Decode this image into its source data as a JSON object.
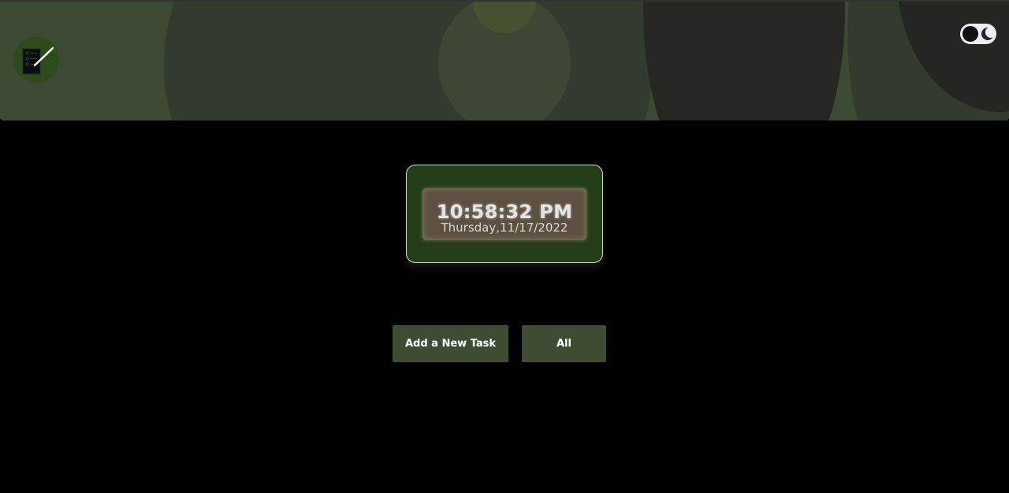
{
  "header": {
    "logo_icon": "task-list-pen-icon",
    "theme_toggle": {
      "state": "dark",
      "icon": "moon-icon"
    }
  },
  "clock": {
    "time": "10:58:32 PM",
    "date": "Thursday,11/17/2022"
  },
  "actions": {
    "add_task_label": "Add a New Task",
    "filter_label": "All"
  },
  "colors": {
    "background": "#000000",
    "header": "#3d4a33",
    "clock_card": "#253e1a",
    "button": "#3e4c33"
  }
}
